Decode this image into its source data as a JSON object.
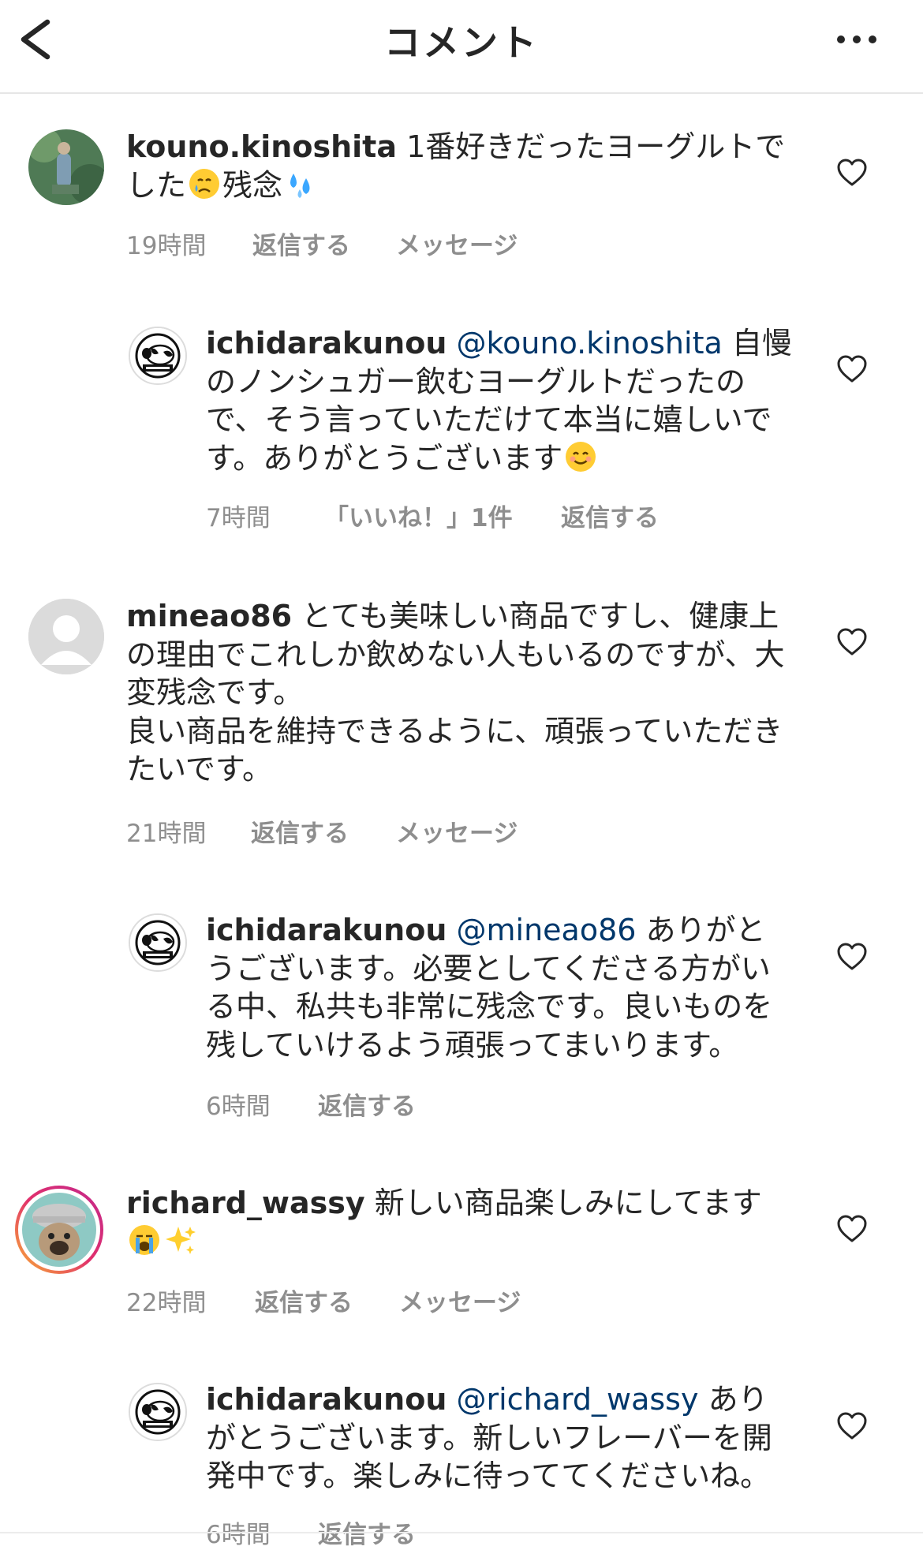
{
  "header": {
    "title": "コメント",
    "back_icon": "chevron-left-icon",
    "more_icon": "more-horizontal-icon"
  },
  "comments": [
    {
      "username": "kouno.kinoshita",
      "text_1": "1番好きだったヨーグルトでした",
      "emoji_1": "crying-face",
      "text_2": "残念",
      "emoji_2": "sweat-droplets",
      "time": "19時間",
      "reply": "返信する",
      "message": "メッセージ"
    },
    {
      "username": "ichidarakunou",
      "mention": "@kouno.kinoshita",
      "text_1": "自慢のノンシュガー飲むヨーグルトだったので、そう言っていただけて本当に嬉しいです。ありがとうございます",
      "emoji_1": "smiling-face",
      "time": "7時間",
      "likes": "「いいね！」1件",
      "reply": "返信する"
    },
    {
      "username": "mineao86",
      "text_1": "とても美味しい商品ですし、健康上の理由でこれしか飲めない人もいるのですが、大変残念です。",
      "text_2": "良い商品を維持できるように、頑張っていただきたいです。",
      "time": "21時間",
      "reply": "返信する",
      "message": "メッセージ"
    },
    {
      "username": "ichidarakunou",
      "mention": "@mineao86",
      "text_1": "ありがとうございます。必要としてくださる方がいる中、私共も非常に残念です。良いものを残していけるよう頑張ってまいります。",
      "time": "6時間",
      "reply": "返信する"
    },
    {
      "username": "richard_wassy",
      "text_1": "新しい商品楽しみにしてます",
      "emoji_1": "loudly-crying-face",
      "emoji_2": "sparkles",
      "time": "22時間",
      "reply": "返信する",
      "message": "メッセージ"
    },
    {
      "username": "ichidarakunou",
      "mention": "@richard_wassy",
      "text_1": "ありがとうございます。新しいフレーバーを開発中です。楽しみに待っててくださいね。",
      "time": "6時間",
      "reply": "返信する"
    }
  ],
  "colors": {
    "text": "#262626",
    "secondary": "#8e8e8e",
    "mention": "#00376b",
    "story_ring_start": "#f9b233",
    "story_ring_end": "#c2288e"
  }
}
